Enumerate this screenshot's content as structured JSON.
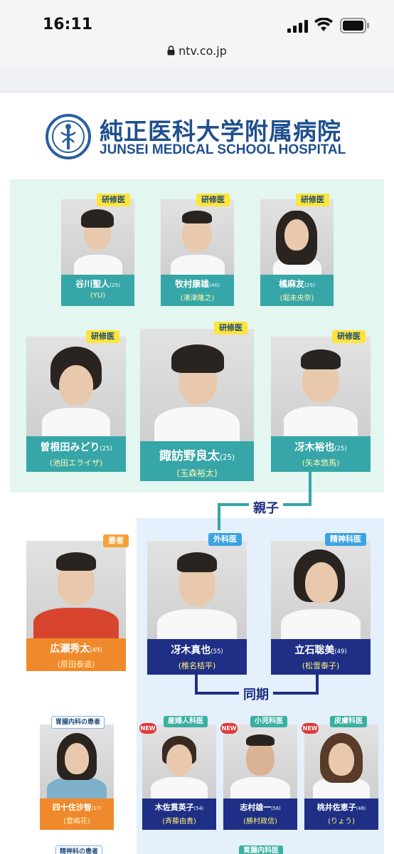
{
  "status_bar": {
    "time": "16:11"
  },
  "browser": {
    "url": "ntv.co.jp"
  },
  "hospital": {
    "name_jp": "純正医科大学附属病院",
    "name_en": "JUNSEI MEDICAL SCHOOL HOSPITAL"
  },
  "row1": [
    {
      "tag": "研修医",
      "name": "谷川聖人",
      "age": "(25)",
      "actor": "(YU)"
    },
    {
      "tag": "研修医",
      "name": "牧村康雄",
      "age": "(40)",
      "actor": "(濱津隆之)"
    },
    {
      "tag": "研修医",
      "name": "橘麻友",
      "age": "(25)",
      "actor": "(堀未央奈)"
    }
  ],
  "row2": [
    {
      "tag": "研修医",
      "name": "曽根田みどり",
      "age": "(25)",
      "actor": "(池田エライザ)"
    },
    {
      "tag": "研修医",
      "name": "諏訪野良太",
      "age": "(25)",
      "actor": "(玉森裕太)"
    },
    {
      "tag": "研修医",
      "name": "冴木裕也",
      "age": "(25)",
      "actor": "(矢本悠馬)"
    }
  ],
  "relations": {
    "parent_child": "親子",
    "same_year": "同期"
  },
  "row3": [
    {
      "tag": "患者",
      "name": "広瀬秀太",
      "age": "(49)",
      "actor": "(原田泰造)"
    },
    {
      "tag": "外科医",
      "name": "冴木真也",
      "age": "(55)",
      "actor": "(椎名桔平)"
    },
    {
      "tag": "精神科医",
      "name": "立石聡美",
      "age": "(49)",
      "actor": "(松雪泰子)"
    }
  ],
  "row4": [
    {
      "tag": "胃腸内科の患者",
      "name": "四十住沙智",
      "age": "(17)",
      "actor": "(豊嶋花)"
    },
    {
      "tag": "産婦人科医",
      "new": "NEW",
      "name": "木佐貫英子",
      "age": "(54)",
      "actor": "(斉藤由貴)"
    },
    {
      "tag": "小児科医",
      "new": "NEW",
      "name": "志村雄一",
      "age": "(56)",
      "actor": "(勝村政信)"
    },
    {
      "tag": "皮膚科医",
      "new": "NEW",
      "name": "桃井佐恵子",
      "age": "(48)",
      "actor": "(りょう)"
    }
  ],
  "bottom_partial": {
    "tag_left": "精神科の患者",
    "tag_right": "胃腸内科医"
  },
  "colors": {
    "teal": "#36a6a8",
    "navy": "#1f2f86",
    "orange": "#ef8a2c",
    "tag_yellow": "#ffe43a"
  }
}
